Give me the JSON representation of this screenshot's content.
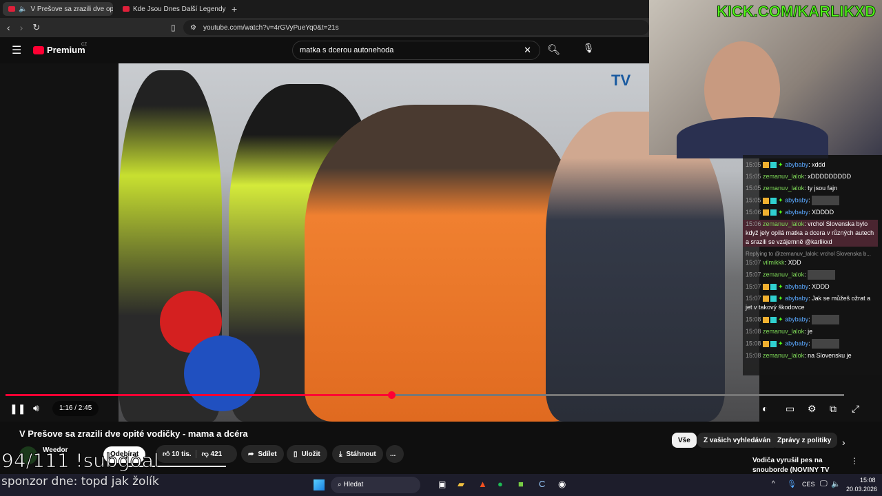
{
  "browser": {
    "tabs": [
      {
        "label": "V Prešove sa zrazili dve opité",
        "active": true
      },
      {
        "label": "Kde Jsou Dnes Další Legendy Českos",
        "active": false
      }
    ],
    "new_tab": "+",
    "url": "youtube.com/watch?v=4rGVyPueYq0&t=21s"
  },
  "youtube": {
    "logo": "Premium",
    "region": "CZ",
    "search_value": "matka s dcerou autonehoda"
  },
  "player": {
    "time": "1:16 / 2:45",
    "progress_fraction": 0.46,
    "watermark": "TV"
  },
  "video": {
    "title": "V Prešove sa zrazili dve opité vodičky - mama a dcéra",
    "channel": "Weedor",
    "subscribe": "Odebírat",
    "likes": "10 tis.",
    "dislikes": "421",
    "share": "Sdílet",
    "save": "Uložit",
    "download": "Stáhnout",
    "more": "..."
  },
  "chips": [
    "Vše",
    "Z vašich vyhledávání",
    "Zprávy z politiky"
  ],
  "recommended": {
    "title": "Vodiča vyrušil pes na snouborde (NOVINY TV JOJ)"
  },
  "stream": {
    "kick": "KICK.COM/KARLIKXD",
    "subgoal": "94/111 !subgoal",
    "sponsor": "sponzor dne: topd jak žolík"
  },
  "chat": [
    {
      "t": "15:05",
      "u": "abybaby",
      "c": "u1",
      "b": true,
      "m": "xddd"
    },
    {
      "t": "15:05",
      "u": "zemanuv_lalok",
      "c": "u2",
      "m": "xDDDDDDDDD"
    },
    {
      "t": "15:05",
      "u": "zemanuv_lalok",
      "c": "u2",
      "m": "ty jsou fajn"
    },
    {
      "t": "15:05",
      "u": "abybaby",
      "c": "u1",
      "b": true,
      "m": "",
      "emote": true
    },
    {
      "t": "15:06",
      "u": "abybaby",
      "c": "u1",
      "b": true,
      "m": "XDDDD"
    },
    {
      "t": "15:06",
      "u": "zemanuv_lalok",
      "c": "u2",
      "m": "vrchol Slovenska bylo když jely opilá matka a dcera v různých autech a srazili se vzájemně @karlikxd",
      "hl": true
    },
    {
      "reply": "Replying to @zemanuv_lalok: vrchol Slovenska b...",
      "t": "15:07",
      "u": "vilmikkk",
      "c": "u2",
      "m": "XDD"
    },
    {
      "t": "15:07",
      "u": "zemanuv_lalok",
      "c": "u2",
      "m": "",
      "emote": true
    },
    {
      "t": "15:07",
      "u": "abybaby",
      "c": "u1",
      "b": true,
      "m": "XDDD"
    },
    {
      "t": "15:07",
      "u": "abybaby",
      "c": "u1",
      "b": true,
      "m": "Jak se můžeš ožrat a jet v takový škodovce"
    },
    {
      "t": "15:08",
      "u": "abybaby",
      "c": "u1",
      "b": true,
      "m": "",
      "emote": true
    },
    {
      "t": "15:08",
      "u": "zemanuv_lalok",
      "c": "u2",
      "m": "je"
    },
    {
      "t": "15:08",
      "u": "abybaby",
      "c": "u1",
      "b": true,
      "m": "",
      "emote": true
    },
    {
      "t": "15:08",
      "u": "zemanuv_lalok",
      "c": "u2",
      "m": "na Slovensku je"
    }
  ],
  "taskbar": {
    "search": "Hledat",
    "lang": "CES",
    "time": "15:08",
    "date": "20.03.2026"
  },
  "colors": {
    "accent": "#ff0033",
    "kick": "#53fc18"
  }
}
